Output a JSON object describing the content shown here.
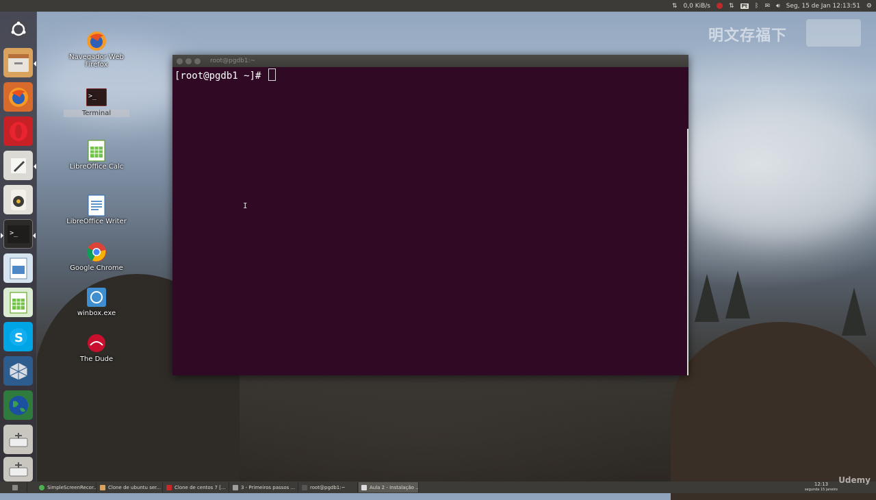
{
  "top_panel": {
    "network_speed": "0,0 KiB/s",
    "datetime": "Seg, 15 de Jan 12:13:51",
    "pg_label": "Pt"
  },
  "watermark": {
    "text": "明文存福下"
  },
  "launcher": {
    "items": [
      {
        "name": "ubuntu-dash"
      },
      {
        "name": "files"
      },
      {
        "name": "firefox"
      },
      {
        "name": "opera"
      },
      {
        "name": "text-editor"
      },
      {
        "name": "rhythmbox"
      },
      {
        "name": "terminal"
      },
      {
        "name": "image-viewer"
      },
      {
        "name": "libreoffice-calc"
      },
      {
        "name": "skype"
      },
      {
        "name": "virtualbox"
      },
      {
        "name": "globe"
      },
      {
        "name": "drive-1"
      },
      {
        "name": "drive-2"
      }
    ]
  },
  "desktop": {
    "icons": [
      {
        "label": "Navegador Web Firefox"
      },
      {
        "label": "Terminal"
      },
      {
        "label": "LibreOffice Calc"
      },
      {
        "label": "LibreOffice Writer"
      },
      {
        "label": "Google Chrome"
      },
      {
        "label": "winbox.exe"
      },
      {
        "label": "The Dude"
      }
    ]
  },
  "terminal": {
    "title": "root@pgdb1:~",
    "prompt": "[root@pgdb1 ~]#"
  },
  "taskbar": {
    "tasks": [
      {
        "label": "SimpleScreenRecor..."
      },
      {
        "label": "Clone de ubuntu ser..."
      },
      {
        "label": "Clone de centos 7 [..."
      },
      {
        "label": "3 - Primeiros passos ..."
      },
      {
        "label": "root@pgdb1:~"
      },
      {
        "label": "Aula 2 - Instalação ..."
      }
    ],
    "clock_time": "12:13",
    "clock_date": "segunda 15 janeiro"
  },
  "branding": {
    "text": "Udemy"
  },
  "colors": {
    "terminal_bg": "#300a24",
    "panel_bg": "#3c3b37"
  }
}
